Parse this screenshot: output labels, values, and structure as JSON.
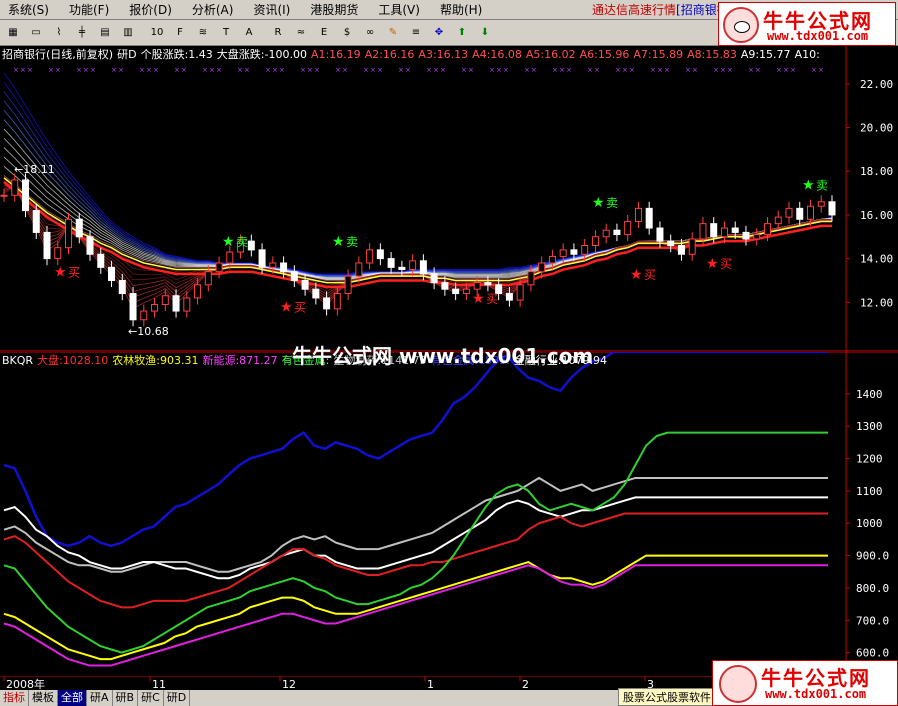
{
  "menu": {
    "items": [
      "系统(S)",
      "功能(F)",
      "报价(D)",
      "分析(A)",
      "资讯(I)",
      "港股期货",
      "工具(V)",
      "帮助(H)"
    ],
    "right_text": "通达信高速行情",
    "right_highlight": "[招商银行]"
  },
  "toolbar": {
    "buttons": [
      "grid-icon",
      "window-icon",
      "line-chart-icon",
      "kline-icon",
      "table-icon",
      "bars-icon",
      "10",
      "f10-icon",
      "compare-icon",
      "text-icon",
      "A",
      "rsi-icon",
      "spread-icon",
      "etf-icon",
      "dollar-icon",
      "link-icon",
      "pencil-icon",
      "lines-icon",
      "move-icon",
      "up-arrow-icon",
      "down-arrow-icon"
    ]
  },
  "logo": {
    "name": "牛牛公式网",
    "url": "www.tdx001.com"
  },
  "main_header": [
    {
      "text": "招商银行(日线,前复权)",
      "color": "#ffffff"
    },
    {
      "text": "研D",
      "color": "#ffffff"
    },
    {
      "text": "个股涨跌:1.43",
      "color": "#ffffff"
    },
    {
      "text": "大盘涨跌:-100.00",
      "color": "#ffffff"
    },
    {
      "text": "A1:16.19",
      "color": "#ff5050"
    },
    {
      "text": "A2:16.16",
      "color": "#ff5050"
    },
    {
      "text": "A3:16.13",
      "color": "#ff5050"
    },
    {
      "text": "A4:16.08",
      "color": "#ff5050"
    },
    {
      "text": "A5:16.02",
      "color": "#ff5050"
    },
    {
      "text": "A6:15.96",
      "color": "#ff5050"
    },
    {
      "text": "A7:15.89",
      "color": "#ff5050"
    },
    {
      "text": "A8:15.83",
      "color": "#ff5050"
    },
    {
      "text": "A9:15.77",
      "color": "#ffffff"
    },
    {
      "text": "A10:",
      "color": "#ffffff"
    }
  ],
  "lower_header": [
    {
      "text": "BKQR",
      "color": "#ffffff"
    },
    {
      "text": "大盘:1028.10",
      "color": "#ff3030"
    },
    {
      "text": "农林牧渔:903.31",
      "color": "#ffff00"
    },
    {
      "text": "新能源:871.27",
      "color": "#ff40ff"
    },
    {
      "text": "有色金属:",
      "color": "#40ff40"
    },
    {
      "text": "生物制药:1141.75",
      "color": "#c0c0c0"
    },
    {
      "text": "有色金属:1535.",
      "color": "#4040ff"
    },
    {
      "text": "金融行业:1079.94",
      "color": "#ffffff"
    }
  ],
  "watermark": "牛牛公式网 www.tdx001.com",
  "main_yaxis": [
    "22.00",
    "20.00",
    "18.00",
    "16.00",
    "14.00",
    "12.00"
  ],
  "lower_yaxis": [
    "1400",
    "1300",
    "1200",
    "1100",
    "1000",
    "900.0",
    "800.0",
    "700.0",
    "600.0"
  ],
  "date_axis": [
    "2008年",
    "11",
    "12",
    "1",
    "2",
    "3"
  ],
  "annotations": {
    "high": "18.11",
    "low": "10.68",
    "buy": "买",
    "sell": "卖"
  },
  "bottom_tabs": [
    "指标",
    "模板",
    "全部",
    "研A",
    "研B",
    "研C",
    "研D"
  ],
  "bottom_right": "股票公式股票软件",
  "chart_data": [
    {
      "type": "line",
      "title": "招商银行(日线,前复权)",
      "ylim": [
        10,
        23
      ],
      "series": [
        {
          "name": "close",
          "values": [
            16.9,
            17.6,
            16.2,
            15.2,
            14.0,
            14.5,
            15.8,
            15.0,
            14.2,
            13.6,
            13.0,
            12.4,
            11.2,
            11.6,
            11.9,
            12.3,
            11.6,
            12.2,
            12.8,
            13.4,
            13.8,
            14.3,
            14.8,
            14.4,
            13.6,
            13.8,
            13.4,
            13.0,
            12.6,
            12.2,
            11.7,
            12.4,
            13.2,
            13.8,
            14.4,
            14.0,
            13.6,
            13.5,
            13.9,
            13.3,
            12.9,
            12.6,
            12.4,
            12.6,
            12.9,
            12.8,
            12.4,
            12.1,
            12.8,
            13.4,
            13.8,
            14.1,
            14.4,
            14.2,
            14.6,
            15.0,
            15.3,
            15.1,
            15.7,
            16.3,
            15.4,
            14.8,
            14.6,
            14.2,
            14.9,
            15.6,
            15.0,
            15.4,
            15.2,
            14.9,
            15.1,
            15.6,
            15.9,
            16.3,
            15.8,
            16.4,
            16.6,
            16.0
          ]
        },
        {
          "name": "A1",
          "values": [
            22.5,
            21.8,
            21.0,
            20.2,
            19.4,
            18.7,
            18.0,
            17.4,
            16.8,
            16.2,
            15.7,
            15.3,
            15.0,
            14.7,
            14.5,
            14.2,
            14.1,
            14.0,
            13.9,
            13.9,
            13.8,
            13.8,
            13.8,
            13.8,
            13.7,
            13.6,
            13.6,
            13.5,
            13.4,
            13.3,
            13.3,
            13.3,
            13.3,
            13.4,
            13.4,
            13.4,
            13.4,
            13.4,
            13.5,
            13.5,
            13.5,
            13.5,
            13.5,
            13.5,
            13.5,
            13.5,
            13.5,
            13.6,
            13.6,
            13.7,
            13.8,
            13.9,
            14.0,
            14.1,
            14.2,
            14.3,
            14.4,
            14.5,
            14.6,
            14.7,
            14.8,
            14.8,
            14.8,
            14.8,
            14.9,
            14.9,
            15.0,
            15.0,
            15.1,
            15.1,
            15.2,
            15.3,
            15.4,
            15.5,
            15.6,
            15.7,
            15.8,
            15.9
          ]
        },
        {
          "name": "A6",
          "values": [
            17.8,
            17.4,
            17.0,
            16.6,
            16.2,
            15.9,
            15.6,
            15.3,
            15.1,
            14.8,
            14.6,
            14.3,
            14.1,
            13.9,
            13.8,
            13.7,
            13.6,
            13.6,
            13.6,
            13.6,
            13.6,
            13.7,
            13.7,
            13.7,
            13.6,
            13.5,
            13.4,
            13.3,
            13.2,
            13.1,
            13.0,
            13.0,
            13.0,
            13.1,
            13.2,
            13.3,
            13.3,
            13.3,
            13.3,
            13.3,
            13.2,
            13.2,
            13.1,
            13.1,
            13.1,
            13.1,
            13.1,
            13.1,
            13.2,
            13.3,
            13.5,
            13.6,
            13.8,
            13.9,
            14.0,
            14.2,
            14.3,
            14.5,
            14.6,
            14.8,
            14.8,
            14.8,
            14.8,
            14.8,
            14.9,
            14.9,
            15.0,
            15.1,
            15.1,
            15.1,
            15.2,
            15.3,
            15.4,
            15.5,
            15.6,
            15.7,
            15.8,
            15.8
          ]
        }
      ]
    },
    {
      "type": "line",
      "title": "BKQR",
      "ylim": [
        540,
        1480
      ],
      "series": [
        {
          "name": "有色金属",
          "values": [
            1180,
            1170,
            1100,
            1020,
            960,
            940,
            930,
            940,
            960,
            940,
            930,
            940,
            960,
            980,
            990,
            1020,
            1050,
            1060,
            1080,
            1100,
            1120,
            1150,
            1180,
            1200,
            1210,
            1220,
            1230,
            1260,
            1280,
            1240,
            1230,
            1250,
            1240,
            1230,
            1210,
            1200,
            1220,
            1240,
            1260,
            1270,
            1280,
            1320,
            1370,
            1390,
            1420,
            1460,
            1500,
            1520,
            1480,
            1450,
            1440,
            1420,
            1410,
            1450,
            1480,
            1500,
            1510,
            1530,
            1530,
            1530,
            1530,
            1530,
            1530,
            1530,
            1530,
            1530,
            1530,
            1530,
            1530,
            1530,
            1530,
            1530,
            1530,
            1530,
            1530,
            1530,
            1530,
            1530
          ]
        },
        {
          "name": "生物制药",
          "values": [
            980,
            990,
            970,
            940,
            920,
            900,
            880,
            870,
            870,
            860,
            850,
            850,
            860,
            870,
            880,
            880,
            880,
            880,
            870,
            860,
            850,
            850,
            860,
            870,
            880,
            900,
            930,
            950,
            960,
            950,
            960,
            940,
            930,
            920,
            920,
            920,
            930,
            940,
            950,
            960,
            970,
            990,
            1010,
            1030,
            1050,
            1070,
            1080,
            1090,
            1100,
            1120,
            1140,
            1120,
            1100,
            1110,
            1120,
            1100,
            1110,
            1120,
            1130,
            1140,
            1140,
            1140,
            1140,
            1140,
            1140,
            1140,
            1140,
            1140,
            1140,
            1140,
            1140,
            1140,
            1140,
            1140,
            1140,
            1140,
            1140,
            1140
          ]
        },
        {
          "name": "金融行业",
          "values": [
            1040,
            1050,
            1020,
            980,
            960,
            930,
            910,
            900,
            880,
            870,
            860,
            860,
            870,
            880,
            880,
            870,
            860,
            860,
            850,
            840,
            830,
            830,
            840,
            860,
            870,
            880,
            900,
            910,
            920,
            900,
            900,
            880,
            870,
            860,
            860,
            860,
            870,
            880,
            890,
            900,
            910,
            930,
            950,
            970,
            990,
            1010,
            1040,
            1060,
            1070,
            1060,
            1040,
            1030,
            1020,
            1030,
            1040,
            1040,
            1050,
            1060,
            1070,
            1080,
            1080,
            1080,
            1080,
            1080,
            1080,
            1080,
            1080,
            1080,
            1080,
            1080,
            1080,
            1080,
            1080,
            1080,
            1080,
            1080,
            1080,
            1080
          ]
        },
        {
          "name": "大盘",
          "values": [
            950,
            960,
            940,
            910,
            880,
            850,
            820,
            800,
            780,
            760,
            750,
            740,
            740,
            750,
            760,
            760,
            760,
            760,
            770,
            780,
            790,
            800,
            820,
            840,
            860,
            880,
            900,
            920,
            920,
            900,
            890,
            870,
            860,
            850,
            840,
            840,
            850,
            860,
            870,
            870,
            880,
            880,
            890,
            900,
            910,
            920,
            930,
            940,
            950,
            980,
            1000,
            1010,
            1020,
            1000,
            990,
            1000,
            1010,
            1020,
            1030,
            1030,
            1030,
            1030,
            1030,
            1030,
            1030,
            1030,
            1030,
            1030,
            1030,
            1030,
            1030,
            1030,
            1030,
            1030,
            1030,
            1030,
            1030,
            1030
          ]
        },
        {
          "name": "有色金属(绿)",
          "values": [
            870,
            860,
            820,
            780,
            740,
            710,
            680,
            660,
            640,
            620,
            610,
            600,
            610,
            620,
            640,
            660,
            680,
            700,
            720,
            740,
            750,
            760,
            770,
            790,
            800,
            810,
            820,
            830,
            820,
            800,
            790,
            770,
            760,
            750,
            750,
            760,
            770,
            780,
            800,
            810,
            830,
            860,
            900,
            950,
            1000,
            1050,
            1090,
            1110,
            1120,
            1100,
            1060,
            1040,
            1050,
            1060,
            1050,
            1040,
            1060,
            1080,
            1120,
            1180,
            1240,
            1270,
            1280,
            1280,
            1280,
            1280,
            1280,
            1280,
            1280,
            1280,
            1280,
            1280,
            1280,
            1280,
            1280,
            1280,
            1280,
            1280
          ]
        },
        {
          "name": "农林牧渔",
          "values": [
            720,
            710,
            690,
            670,
            650,
            630,
            610,
            600,
            590,
            580,
            580,
            590,
            600,
            610,
            620,
            630,
            650,
            660,
            680,
            690,
            700,
            710,
            720,
            740,
            750,
            760,
            770,
            770,
            760,
            740,
            730,
            720,
            720,
            720,
            730,
            740,
            750,
            760,
            770,
            780,
            790,
            800,
            810,
            820,
            830,
            840,
            850,
            860,
            870,
            880,
            860,
            840,
            830,
            830,
            820,
            810,
            820,
            840,
            860,
            880,
            900,
            900,
            900,
            900,
            900,
            900,
            900,
            900,
            900,
            900,
            900,
            900,
            900,
            900,
            900,
            900,
            900,
            900
          ]
        },
        {
          "name": "新能源",
          "values": [
            690,
            680,
            660,
            640,
            620,
            600,
            580,
            570,
            560,
            560,
            560,
            570,
            580,
            590,
            600,
            610,
            620,
            630,
            640,
            650,
            660,
            670,
            680,
            690,
            700,
            710,
            720,
            720,
            710,
            700,
            690,
            690,
            700,
            710,
            720,
            730,
            740,
            750,
            760,
            770,
            780,
            790,
            800,
            810,
            820,
            830,
            840,
            850,
            860,
            870,
            860,
            840,
            820,
            810,
            810,
            800,
            810,
            830,
            850,
            870,
            870,
            870,
            870,
            870,
            870,
            870,
            870,
            870,
            870,
            870,
            870,
            870,
            870,
            870,
            870,
            870,
            870,
            870
          ]
        }
      ]
    }
  ]
}
